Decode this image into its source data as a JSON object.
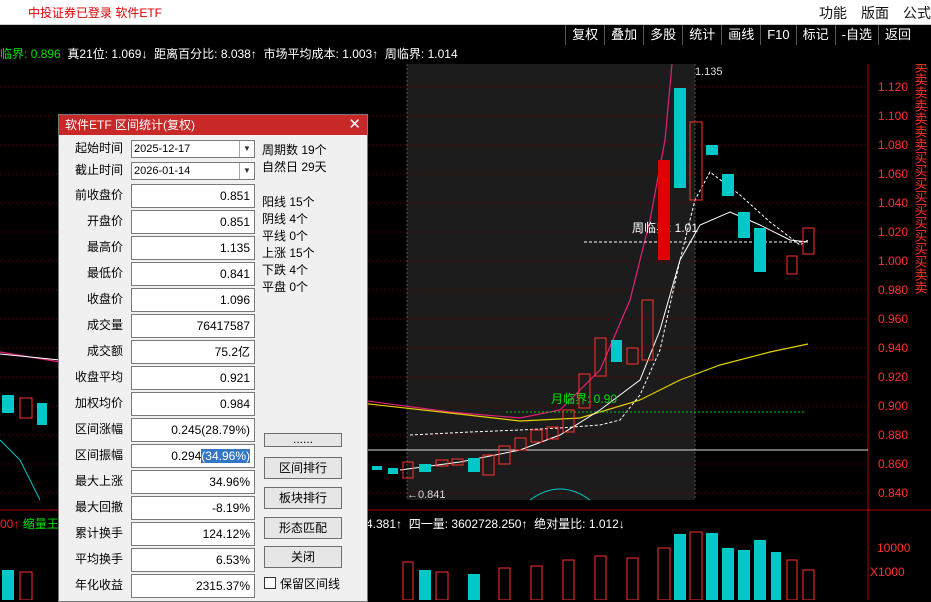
{
  "header": {
    "login_text": "中投证券已登录 软件ETF",
    "menu": [
      "功能",
      "版面",
      "公式"
    ]
  },
  "toolbar": [
    "复权",
    "叠加",
    "多股",
    "统计",
    "画线",
    "F10",
    "标记",
    "-自选",
    "返回"
  ],
  "info": {
    "p1": "临界:",
    "p1v": "0.896",
    "p2": "真21位:",
    "p2v": "1.069↓",
    "p3": "距离百分比:",
    "p3v": "8.038↑",
    "p4": "市场平均成本:",
    "p4v": "1.003↑",
    "p5": "周临界:",
    "p5v": "1.014"
  },
  "chart": {
    "price_ticks": [
      "1.120",
      "1.100",
      "1.080",
      "1.060",
      "1.040",
      "1.020",
      "1.000",
      "0.980",
      "0.960",
      "0.940",
      "0.920",
      "0.900",
      "0.880",
      "0.860",
      "0.840"
    ],
    "high_label": "1.135",
    "low_label": "←0.841",
    "weekly_label": "周临界: 1.01",
    "monthly_label": "月临界: 0.90",
    "volume_ticks": [
      "10000",
      "X1000"
    ],
    "side_chars": "卖卖卖卖卖卖卖买买买买买买买买买卖卖",
    "volume_line": {
      "a": "00↑",
      "b": "缩量王",
      "c": "4.381↑",
      "d": "四一量:",
      "dv": "3602728.250↑",
      "e": "绝对量比:",
      "ev": "1.012↓"
    }
  },
  "dialog": {
    "title": "软件ETF 区间统计(复权)",
    "start_label": "起始时间",
    "start_value": "2025-12-17",
    "end_label": "截止时间",
    "end_value": "2026-01-14",
    "fields": [
      {
        "label": "前收盘价",
        "value": "0.851"
      },
      {
        "label": "开盘价",
        "value": "0.851"
      },
      {
        "label": "最高价",
        "value": "1.135"
      },
      {
        "label": "最低价",
        "value": "0.841"
      },
      {
        "label": "收盘价",
        "value": "1.096"
      },
      {
        "label": "成交量",
        "value": "76417587"
      },
      {
        "label": "成交额",
        "value": "75.2亿"
      },
      {
        "label": "收盘平均",
        "value": "0.921"
      },
      {
        "label": "加权均价",
        "value": "0.984"
      },
      {
        "label": "区间涨幅",
        "value": "0.245(28.79%)"
      },
      {
        "label": "区间振幅",
        "value": "0.294",
        "value_hl": "(34.96%)"
      },
      {
        "label": "最大上涨",
        "value": "34.96%"
      },
      {
        "label": "最大回撤",
        "value": "-8.19%"
      },
      {
        "label": "累计换手",
        "value": "124.12%"
      },
      {
        "label": "平均换手",
        "value": "6.53%"
      },
      {
        "label": "年化收益",
        "value": "2315.37%"
      }
    ],
    "stats": [
      "周期数 19个",
      "自然日 29天"
    ],
    "counts": [
      "阳线 15个",
      "阴线 4个",
      "平线 0个",
      "上涨 15个",
      "下跌 4个",
      "平盘 0个"
    ],
    "buttons": [
      "......",
      "区间排行",
      "板块排行",
      "形态匹配",
      "关闭"
    ],
    "checkbox_label": "保留区间线"
  }
}
